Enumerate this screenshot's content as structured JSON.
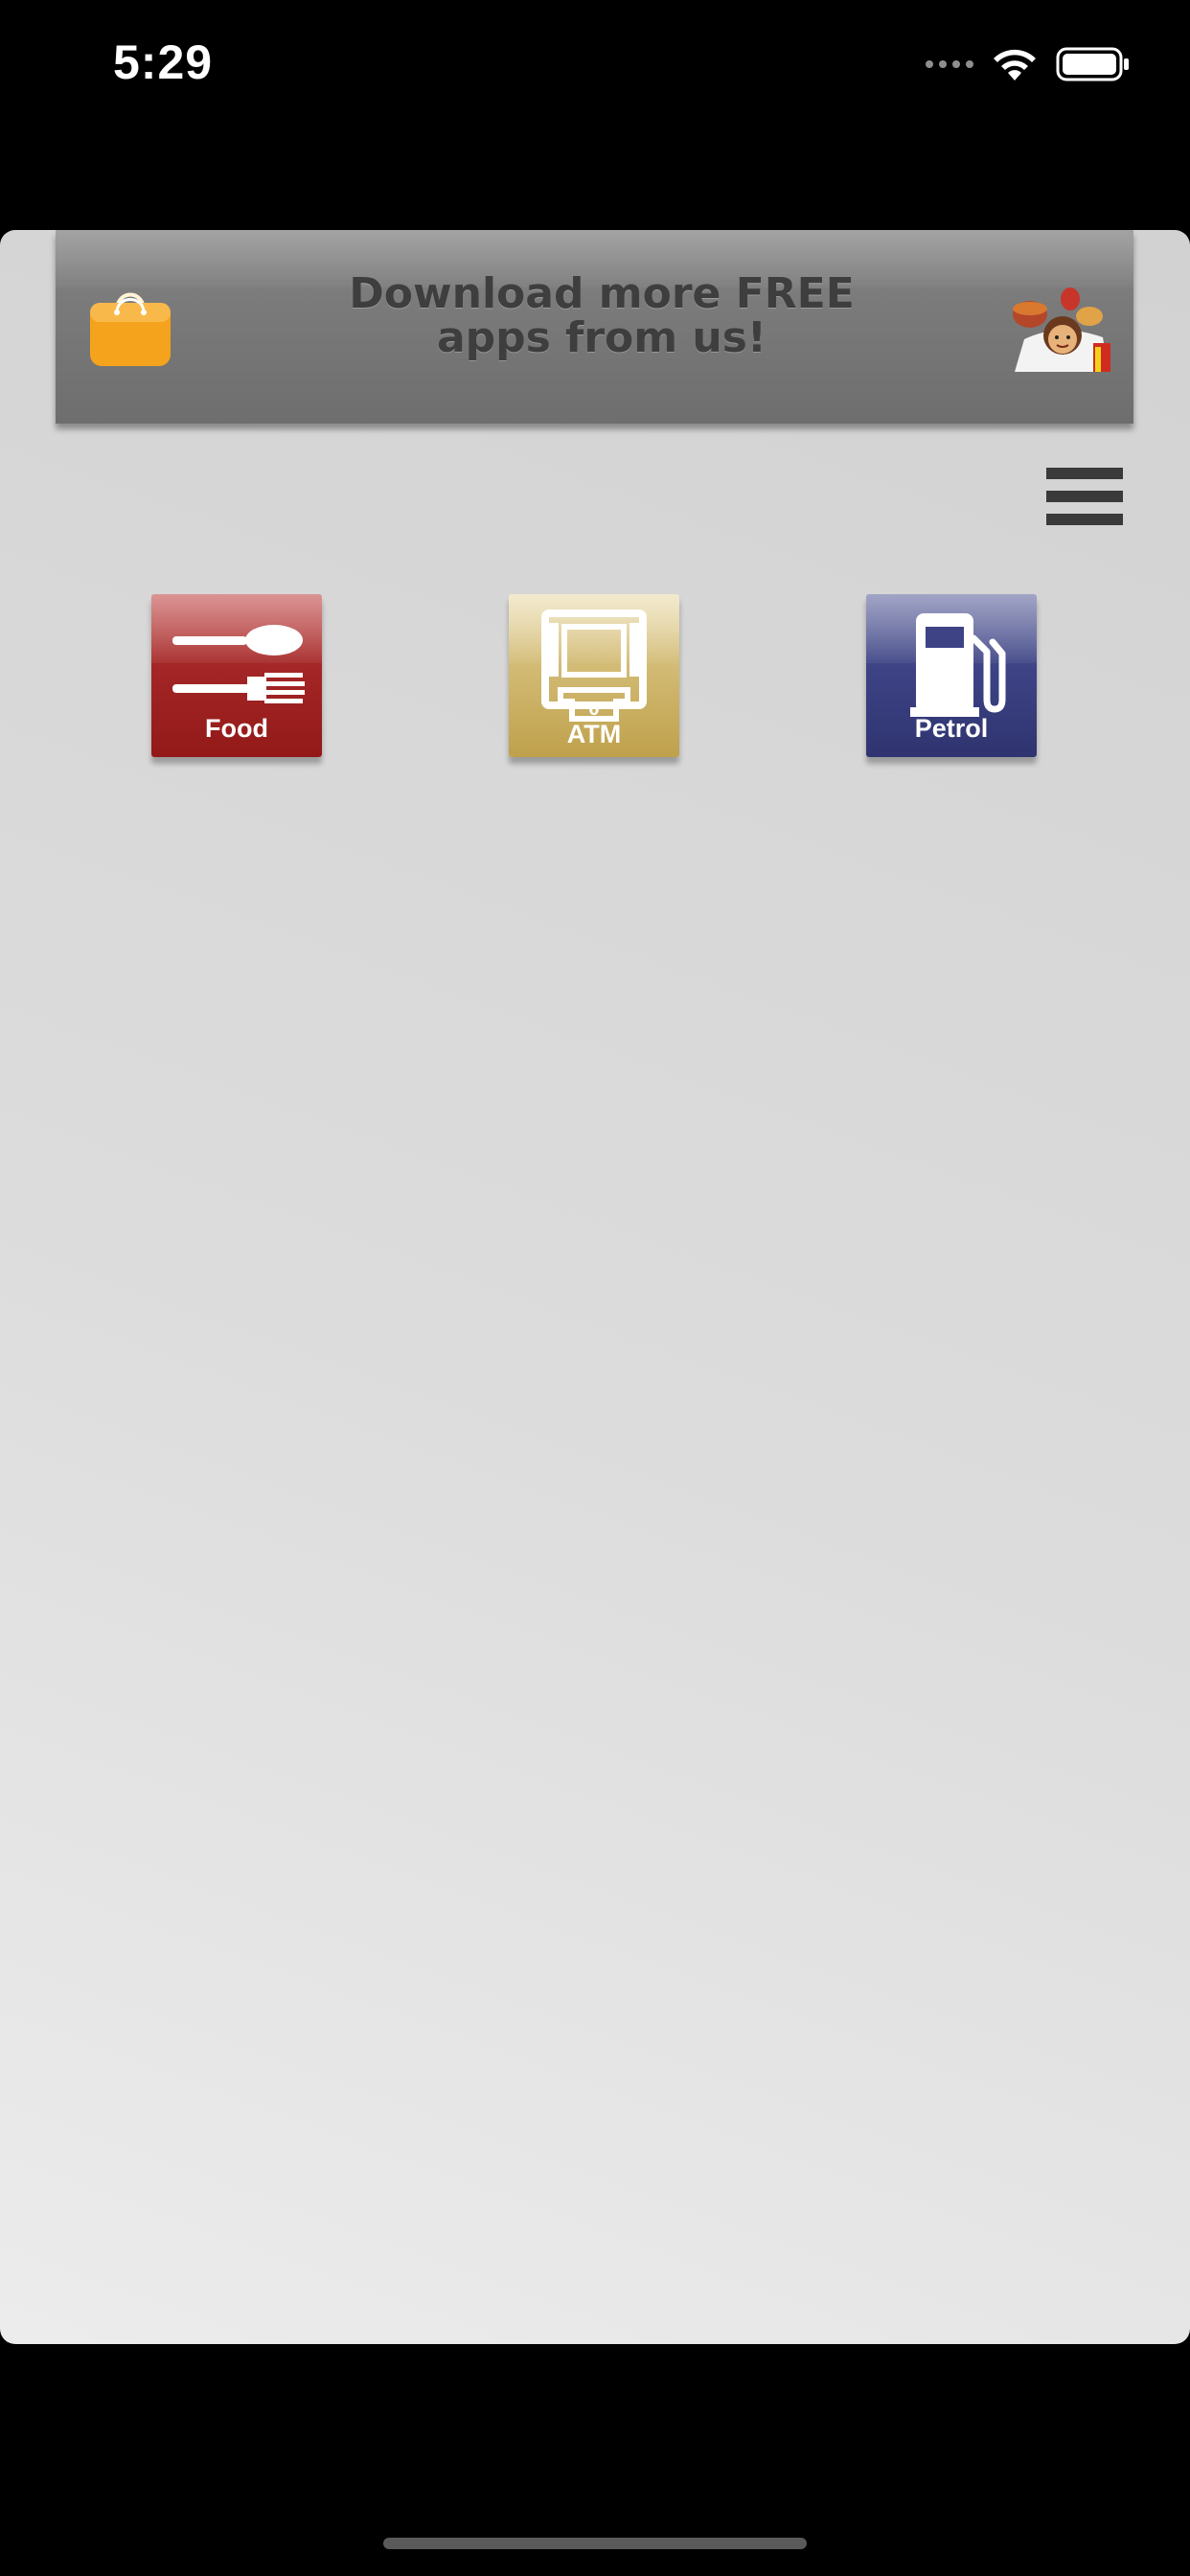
{
  "status_bar": {
    "time": "5:29",
    "icons": [
      "signal-dots-icon",
      "wifi-icon",
      "battery-icon"
    ]
  },
  "banner": {
    "line1": "Download more FREE",
    "line2": "apps from us!",
    "left_icon": "shopping-bag-icon",
    "right_icon": "mascot-icon",
    "bag_color": "#f5a21d"
  },
  "menu": {
    "icon": "hamburger-menu-icon"
  },
  "categories": [
    {
      "label": "Food",
      "icon": "spoon-fork-icon",
      "color": "#a42626"
    },
    {
      "label": "ATM",
      "icon": "atm-machine-icon",
      "color": "#c8ab5c"
    },
    {
      "label": "Petrol",
      "icon": "fuel-pump-icon",
      "color": "#3d4385"
    }
  ]
}
